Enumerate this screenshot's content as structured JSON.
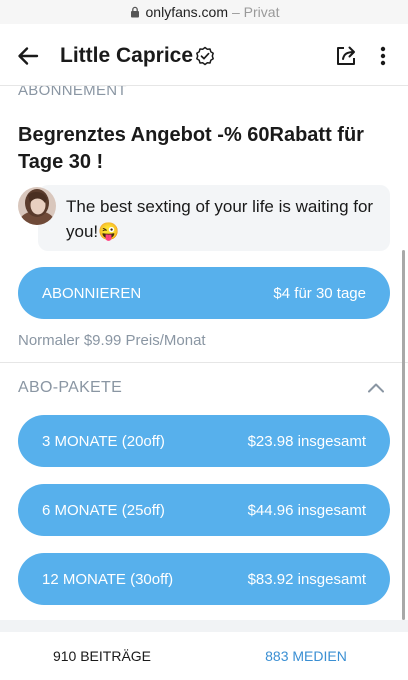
{
  "browser": {
    "domain": "onlyfans.com",
    "suffix": "– Privat"
  },
  "header": {
    "title": "Little Caprice"
  },
  "subscription": {
    "section_label": "ABONNEMENT",
    "offer_title": "Begrenztes Angebot -% 60Rabatt für Tage 30 !",
    "message": "The best sexting of your life is waiting for you!😜",
    "subscribe_label": "ABONNIEREN",
    "subscribe_price": "$4 für 30 tage",
    "regular_price": "Normaler $9.99 Preis/Monat"
  },
  "packages": {
    "label": "ABO-PAKETE",
    "items": [
      {
        "label": "3 MONATE (20off)",
        "price": "$23.98 insgesamt"
      },
      {
        "label": "6 MONATE (25off)",
        "price": "$44.96 insgesamt"
      },
      {
        "label": "12 MONATE (30off)",
        "price": "$83.92 insgesamt"
      }
    ]
  },
  "tabs": {
    "posts": "910 BEITRÄGE",
    "media": "883 MEDIEN"
  },
  "colors": {
    "accent": "#57b0ec",
    "muted": "#8a96a3",
    "link": "#3a8fd3"
  }
}
